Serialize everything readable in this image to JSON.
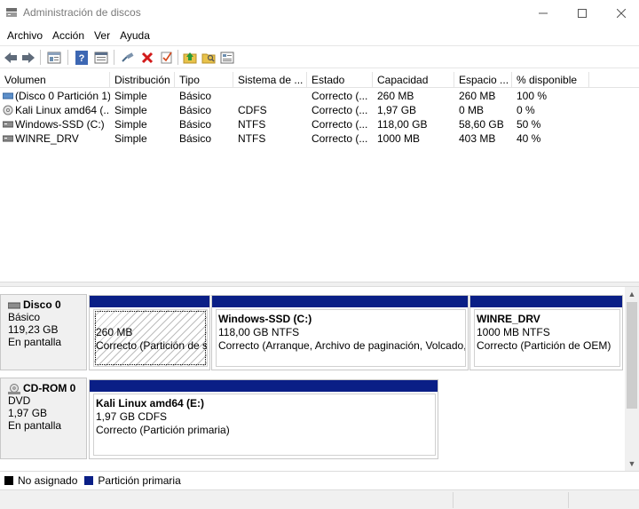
{
  "window": {
    "title": "Administración de discos"
  },
  "menu": [
    "Archivo",
    "Acción",
    "Ver",
    "Ayuda"
  ],
  "toolbar": {
    "icons": [
      "back-icon",
      "forward-icon",
      "properties-icon",
      "help-icon",
      "view-icon",
      "connect-icon",
      "delete-icon",
      "check-icon",
      "up-icon",
      "open-icon",
      "export-icon"
    ]
  },
  "volume_list": {
    "columns": [
      "Volumen",
      "Distribución",
      "Tipo",
      "Sistema de ...",
      "Estado",
      "Capacidad",
      "Espacio ...",
      "% disponible"
    ],
    "rows": [
      {
        "volume": "(Disco 0 Partición 1)",
        "layout": "Simple",
        "type": "Básico",
        "fs": "",
        "status": "Correcto (...",
        "capacity": "260 MB",
        "free": "260 MB",
        "pct": "100 %"
      },
      {
        "volume": "Kali Linux amd64 (...",
        "layout": "Simple",
        "type": "Básico",
        "fs": "CDFS",
        "status": "Correcto (...",
        "capacity": "1,97 GB",
        "free": "0 MB",
        "pct": "0 %"
      },
      {
        "volume": "Windows-SSD (C:)",
        "layout": "Simple",
        "type": "Básico",
        "fs": "NTFS",
        "status": "Correcto (...",
        "capacity": "118,00 GB",
        "free": "58,60 GB",
        "pct": "50 %"
      },
      {
        "volume": "WINRE_DRV",
        "layout": "Simple",
        "type": "Básico",
        "fs": "NTFS",
        "status": "Correcto (...",
        "capacity": "1000 MB",
        "free": "403 MB",
        "pct": "40 %"
      }
    ]
  },
  "disks": [
    {
      "name": "Disco 0",
      "kind": "Básico",
      "size": "119,23 GB",
      "state": "En pantalla",
      "partitions": [
        {
          "name": "",
          "size": "260 MB",
          "status": "Correcto (Partición de si"
        },
        {
          "name": "Windows-SSD  (C:)",
          "size": "118,00 GB NTFS",
          "status": "Correcto (Arranque, Archivo de paginación, Volcado, F"
        },
        {
          "name": "WINRE_DRV",
          "size": "1000 MB NTFS",
          "status": "Correcto (Partición de OEM)"
        }
      ]
    },
    {
      "name": "CD-ROM 0",
      "kind": "DVD",
      "size": "1,97 GB",
      "state": "En pantalla",
      "partitions": [
        {
          "name": "Kali Linux amd64  (E:)",
          "size": "1,97 GB CDFS",
          "status": "Correcto (Partición primaria)"
        }
      ]
    }
  ],
  "legend": [
    {
      "label": "No asignado",
      "color": "#000000"
    },
    {
      "label": "Partición primaria",
      "color": "#0a1f86"
    }
  ]
}
